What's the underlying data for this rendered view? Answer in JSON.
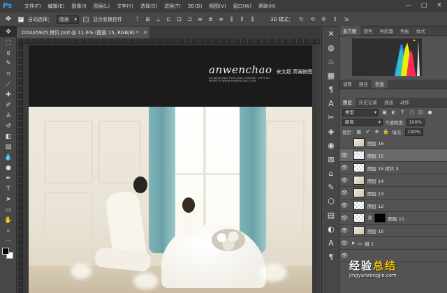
{
  "app": {
    "logo": "Ps"
  },
  "menu": [
    "文件(F)",
    "编辑(E)",
    "图像(I)",
    "图层(L)",
    "文字(Y)",
    "选择(S)",
    "滤镜(T)",
    "3D(D)",
    "视图(V)",
    "窗口(W)",
    "帮助(H)"
  ],
  "window_controls": [
    "—",
    "□",
    "✕"
  ],
  "options_bar": {
    "auto_select_label": "自动选择：",
    "auto_select_value": "图层",
    "show_transform_label": "显示变换控件",
    "mode_3d_label": "3D 模式："
  },
  "document": {
    "tab_title": "DO4A5925 拷贝.psd @ 11.6% (图层 15, RGB/8) *",
    "close_glyph": "×"
  },
  "watermark": {
    "brand": "anwenchao",
    "brand_cn": "安文超 高端修图",
    "sub": "AN WENCHAO HIGH-END SHAPING OFFICIAL WEBSITE:WWW.ANWENCHAO.COM"
  },
  "top_panel_tabs": [
    "直方图",
    "颜色",
    "导航器",
    "色板",
    "样式"
  ],
  "mid_panel_tabs": [
    "调整",
    "路径",
    "信息"
  ],
  "layer_panel_tabs": [
    "图层",
    "历史记录",
    "通道",
    "动作"
  ],
  "layers_panel": {
    "kind_value": "类型",
    "blend_value": "颜色",
    "opacity_label": "不透明度:",
    "opacity_value": "100%",
    "lock_label": "锁定:",
    "fill_label": "填充:",
    "fill_value": "100%"
  },
  "layers": [
    {
      "name": "图层 16",
      "thumb": "pic",
      "visible": false,
      "selected": false
    },
    {
      "name": "图层 15",
      "thumb": "trans",
      "visible": true,
      "selected": true
    },
    {
      "name": "图层 15 拷贝 3",
      "thumb": "trans",
      "visible": true,
      "selected": false
    },
    {
      "name": "图层 14",
      "thumb": "pic",
      "visible": true,
      "selected": false
    },
    {
      "name": "图层 13",
      "thumb": "pic",
      "visible": true,
      "selected": false
    },
    {
      "name": "图层 12",
      "thumb": "trans",
      "visible": true,
      "selected": false
    },
    {
      "name": "图层 11",
      "thumb": "mask",
      "visible": true,
      "selected": false
    },
    {
      "name": "图层 10",
      "thumb": "pic",
      "visible": true,
      "selected": false
    },
    {
      "name": "组 1",
      "thumb": "folder",
      "visible": true,
      "selected": false
    }
  ],
  "site_watermark": {
    "prefix": "经验",
    "highlight": "总结",
    "suffix": "",
    "url": "jingyanzongjie.com"
  }
}
